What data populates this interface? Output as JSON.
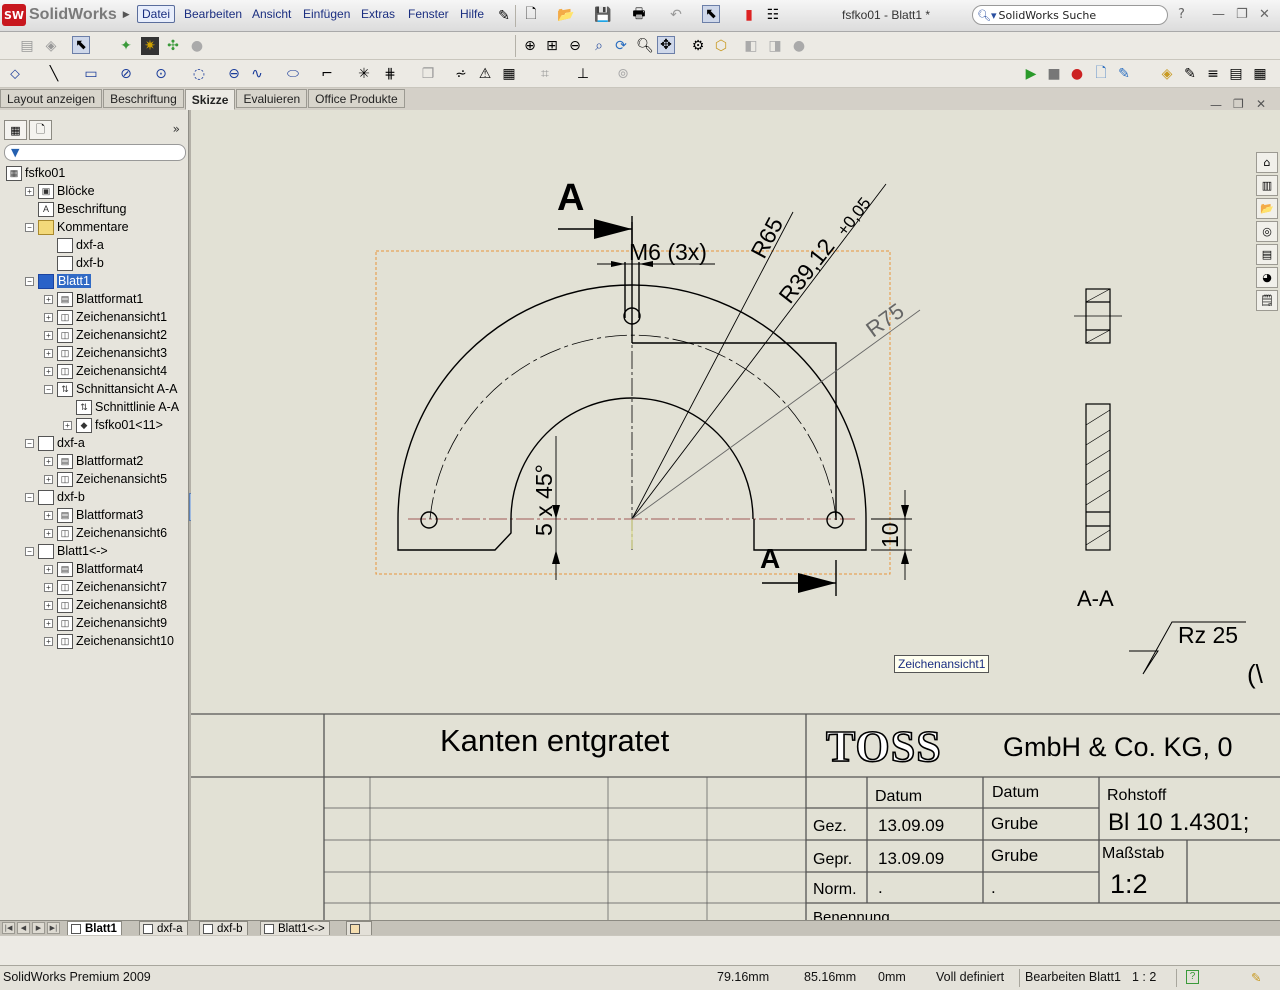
{
  "app": {
    "name": "SolidWorks",
    "logo_letters": "SW"
  },
  "menu": [
    "Datei",
    "Bearbeiten",
    "Ansicht",
    "Einfügen",
    "Extras",
    "Fenster",
    "Hilfe"
  ],
  "document_title": "fsfko01 - Blatt1 *",
  "search": {
    "value": "SolidWorks Suche"
  },
  "command_tabs": [
    "Layout anzeigen",
    "Beschriftung",
    "Skizze",
    "Evaluieren",
    "Office Produkte"
  ],
  "active_command_tab": "Skizze",
  "feature_tree": [
    {
      "label": "fsfko01",
      "level": 0,
      "expander": "",
      "icon": "drawing-icon"
    },
    {
      "label": "Blöcke",
      "level": 1,
      "expander": "+",
      "icon": "blocks-icon"
    },
    {
      "label": "Beschriftung",
      "level": 1,
      "expander": "",
      "icon": "annotation-icon"
    },
    {
      "label": "Kommentare",
      "level": 1,
      "expander": "-",
      "icon": "folder-icon"
    },
    {
      "label": "dxf-a",
      "level": 2,
      "expander": "",
      "icon": "document-icon"
    },
    {
      "label": "dxf-b",
      "level": 2,
      "expander": "",
      "icon": "document-icon"
    },
    {
      "label": "Blatt1",
      "level": 1,
      "expander": "-",
      "icon": "sheet-icon",
      "selected": true
    },
    {
      "label": "Blattformat1",
      "level": 2,
      "expander": "+",
      "icon": "sheet-format-icon"
    },
    {
      "label": "Zeichenansicht1",
      "level": 2,
      "expander": "+",
      "icon": "drawing-view-icon"
    },
    {
      "label": "Zeichenansicht2",
      "level": 2,
      "expander": "+",
      "icon": "drawing-view-icon"
    },
    {
      "label": "Zeichenansicht3",
      "level": 2,
      "expander": "+",
      "icon": "drawing-view-icon"
    },
    {
      "label": "Zeichenansicht4",
      "level": 2,
      "expander": "+",
      "icon": "drawing-view-icon"
    },
    {
      "label": "Schnittansicht A-A",
      "level": 2,
      "expander": "-",
      "icon": "section-view-icon"
    },
    {
      "label": "Schnittlinie A-A",
      "level": 3,
      "expander": "",
      "icon": "section-line-icon"
    },
    {
      "label": "fsfko01<11>",
      "level": 3,
      "expander": "+",
      "icon": "part-icon"
    },
    {
      "label": "dxf-a",
      "level": 1,
      "expander": "-",
      "icon": "sheet-icon"
    },
    {
      "label": "Blattformat2",
      "level": 2,
      "expander": "+",
      "icon": "sheet-format-icon"
    },
    {
      "label": "Zeichenansicht5",
      "level": 2,
      "expander": "+",
      "icon": "drawing-view-icon"
    },
    {
      "label": "dxf-b",
      "level": 1,
      "expander": "-",
      "icon": "sheet-icon"
    },
    {
      "label": "Blattformat3",
      "level": 2,
      "expander": "+",
      "icon": "sheet-format-icon"
    },
    {
      "label": "Zeichenansicht6",
      "level": 2,
      "expander": "+",
      "icon": "drawing-view-icon"
    },
    {
      "label": "Blatt1<->",
      "level": 1,
      "expander": "-",
      "icon": "sheet-icon"
    },
    {
      "label": "Blattformat4",
      "level": 2,
      "expander": "+",
      "icon": "sheet-format-icon"
    },
    {
      "label": "Zeichenansicht7",
      "level": 2,
      "expander": "+",
      "icon": "drawing-view-icon"
    },
    {
      "label": "Zeichenansicht8",
      "level": 2,
      "expander": "+",
      "icon": "drawing-view-icon"
    },
    {
      "label": "Zeichenansicht9",
      "level": 2,
      "expander": "+",
      "icon": "drawing-view-icon"
    },
    {
      "label": "Zeichenansicht10",
      "level": 2,
      "expander": "+",
      "icon": "drawing-view-icon"
    }
  ],
  "drawing": {
    "section_mark": "A",
    "section_mark_bottom": "A",
    "dim_thread": "M6 (3x)",
    "dim_r65": "R65",
    "dim_r39": "R39,12",
    "dim_r39_tol": "+0,05",
    "dim_r75": "R75",
    "dim_chamfer": "5 x 45°",
    "dim_10": "10",
    "section_label": "A-A",
    "surface_finish": "Rz 25",
    "partial_paren": "(\\",
    "view_tooltip": "Zeichenansicht1"
  },
  "title_block": {
    "note": "Kanten entgratet",
    "company_logo": "TOSS",
    "company_name": "GmbH & Co. KG,  0",
    "col_datum1": "Datum",
    "col_datum2": "Datum",
    "row_gez": "Gez.",
    "row_gepr": "Gepr.",
    "row_norm": "Norm.",
    "gez_date": "13.09.09",
    "gez_name": "Grube",
    "gepr_date": "13.09.09",
    "gepr_name": "Grube",
    "norm_date": ".",
    "norm_name": ".",
    "rohstoff_label": "Rohstoff",
    "rohstoff_value": "Bl  10 1.4301;",
    "massstab_label": "Maßstab",
    "massstab_value": "1:2",
    "benennung_label": "Benennung"
  },
  "sheet_tabs": [
    "Blatt1",
    "dxf-a",
    "dxf-b",
    "Blatt1<->"
  ],
  "active_sheet": "Blatt1",
  "status": {
    "product": "SolidWorks Premium 2009",
    "x": "79.16mm",
    "y": "85.16mm",
    "z": "0mm",
    "state": "Voll definiert",
    "editing": "Bearbeiten Blatt1",
    "scale": "1 : 2"
  },
  "colors": {
    "accent": "#316ac5",
    "canvas": "#e2e1d5",
    "logo_red": "#c8171e",
    "view_boundary": "#e8953a"
  }
}
